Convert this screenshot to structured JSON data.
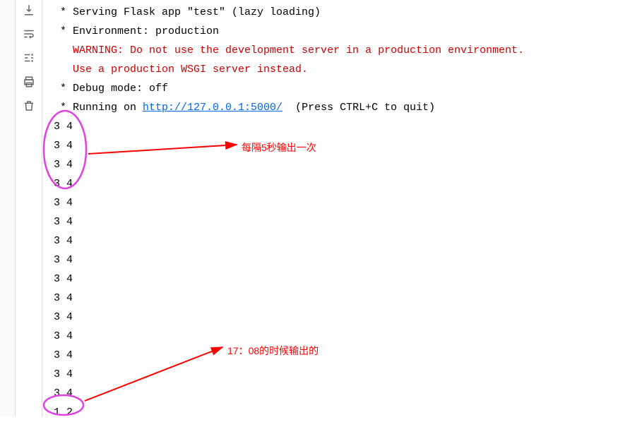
{
  "toolbar": {
    "icons": [
      "download-icon",
      "wrap-icon",
      "settings-icon",
      "print-icon",
      "trash-icon"
    ]
  },
  "console": {
    "serving": " * Serving Flask app \"test\" (lazy loading)",
    "env": " * Environment: production",
    "warn1": "   WARNING: Do not use the development server in a production environment.",
    "warn2": "   Use a production WSGI server instead.",
    "debug": " * Debug mode: off",
    "running_prefix": " * Running on ",
    "running_url": "http://127.0.0.1:5000/",
    "running_suffix": "  (Press CTRL+C to quit)",
    "out_value_a": "3 4",
    "out_value_b": "1 2",
    "repeat_a_count": 15
  },
  "annotations": {
    "a1": "每隔5秒输出一次",
    "a2": "17：08的时候输出的"
  }
}
